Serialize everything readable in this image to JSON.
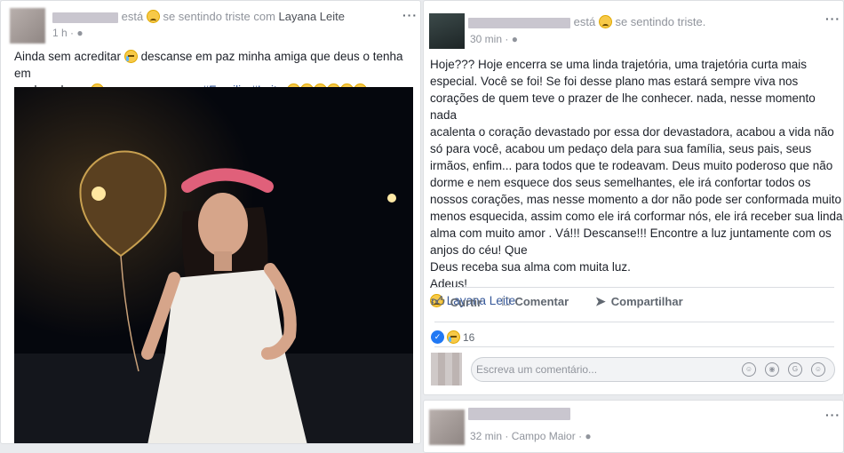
{
  "left_post": {
    "status": "está",
    "feeling": "se sentindo triste com",
    "tagged": "Layana Leite",
    "time": "1 h",
    "text_line1": "Ainda sem acreditar",
    "text_line1b": "descanse em paz minha amiga que deus o tenha em",
    "text_line2a": "um bom lugar",
    "text_line2b": "meus pesames a",
    "hashtag1": "#Familia",
    "hashtag2": "#Leite"
  },
  "right_post": {
    "status": "está",
    "feeling": "se sentindo triste.",
    "time": "30 min",
    "paragraph": [
      "Hoje??? Hoje encerra se uma linda trajetória, uma trajetória curta mais",
      "especial. Você se foi! Se foi desse plano mas estará sempre viva nos",
      "corações de quem teve o prazer de lhe conhecer. nada, nesse momento nada",
      "acalenta o coração devastado por essa dor devastadora, acabou a vida não",
      "só para você, acabou um pedaço dela para sua família, seus pais, seus",
      "irmãos, enfim... para todos que te rodeavam. Deus muito poderoso que não",
      "dorme e nem esquece dos seus semelhantes, ele irá confortar todos os",
      "nossos corações, mas nesse momento a dor não pode ser conformada muito",
      "menos esquecida, assim como ele irá corformar nós, ele irá receber sua linda",
      "alma com muito amor . Vá!!! Descanse!!! Encontre a luz juntamente com os",
      "anjos do céu! Que",
      "Deus receba sua alma com muita luz.",
      "Adeus!"
    ],
    "tagged": "Layana Leite",
    "actions": {
      "like": "Curtir",
      "comment": "Comentar",
      "share": "Compartilhar"
    },
    "reaction_count": "16",
    "comment_placeholder": "Escreva um comentário..."
  },
  "third_post": {
    "time": "32 min",
    "location": "Campo Maior"
  },
  "colors": {
    "link": "#365899",
    "like_blue": "#2078f4",
    "feed_bg": "#e9ebee"
  }
}
